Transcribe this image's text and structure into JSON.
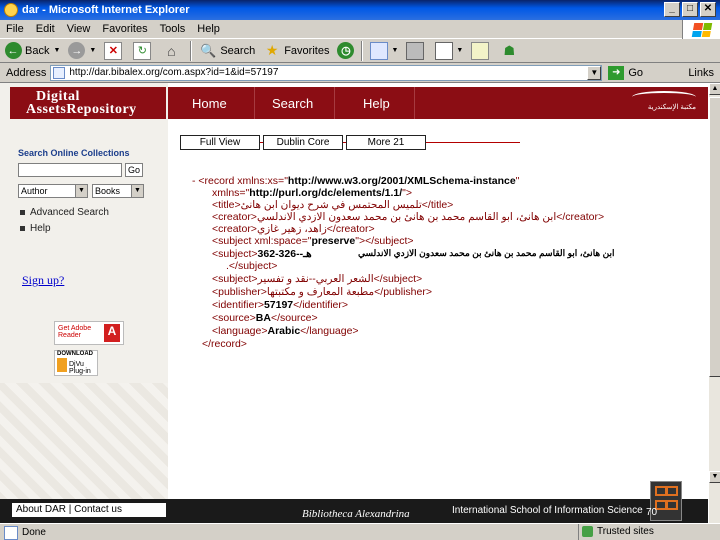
{
  "window": {
    "title": "dar - Microsoft Internet Explorer",
    "min": "_",
    "max": "□",
    "close": "✕"
  },
  "menu": {
    "items": [
      "File",
      "Edit",
      "View",
      "Favorites",
      "Tools",
      "Help"
    ]
  },
  "toolbar": {
    "back": "Back",
    "search": "Search",
    "favorites": "Favorites"
  },
  "address": {
    "label": "Address",
    "url": "http://dar.bibalex.org/com.aspx?id=1&id=57197",
    "go": "Go",
    "links": "Links"
  },
  "site": {
    "logo_line1": "Digital",
    "logo_line2": "AssetsRepository",
    "nav": [
      "Home",
      "Search",
      "Help"
    ],
    "bibalex": "مكتبة الإسكندرية"
  },
  "left": {
    "search_title": "Search Online Collections",
    "go": "Go",
    "field_select": "Author",
    "type_select": "Books",
    "advanced": "Advanced Search",
    "help": "Help",
    "signup": "Sign up?",
    "adobe": "Get Adobe Reader",
    "djvu_top": "DOWNLOAD",
    "djvu": "DjVu Plug-in"
  },
  "views": {
    "full": "Full View",
    "dublin": "Dublin Core",
    "more": "More 21"
  },
  "xml": {
    "l1_a": "- <record xmlns:xs=\"",
    "l1_b": "http://www.w3.org/2001/XMLSchema-instance",
    "l1_c": "\"",
    "l2_a": "xmlns=\"",
    "l2_b": "http://purl.org/dc/elements/1.1/",
    "l2_c": "\">",
    "l3": "<title>تلميس المحتمس في شرح ديوان ابن هانئ</title>",
    "l4": "<creator>ابن هانئ، ابو القاسم محمد بن هانئ بن محمد سعدون الازدي الاندلسي</creator>",
    "l5": "<creator>زاهد، زهير غازي</creator>",
    "l6_a": "<subject xml:space=\"",
    "l6_b": "preserve",
    "l6_c": "\"></subject>",
    "l7_a": "<subject>",
    "l7_b": "362-326--هـ",
    "l7_c": "ابن هانئ، ابو القاسم محمد بن هانئ بن محمد سعدون الازدي الاندلسي",
    "l8": ".</subject>",
    "l9": "<subject>الشعر العربي--نقد و تفسير</subject>",
    "l10": "<publisher>مطبعة المعارف و مكتبتها</publisher>",
    "l11_a": "<identifier>",
    "l11_b": "57197",
    "l11_c": "</identifier>",
    "l12_a": "<source>",
    "l12_b": "BA",
    "l12_c": "</source>",
    "l13_a": "<language>",
    "l13_b": "Arabic",
    "l13_c": "</language>",
    "l14": "</record>"
  },
  "footer": {
    "links": "About DAR | Contact us",
    "library": "Bibliotheca Alexandrina",
    "school": "International School of Information Science",
    "page": "70"
  },
  "status": {
    "done": "Done",
    "zone": "Trusted sites"
  }
}
